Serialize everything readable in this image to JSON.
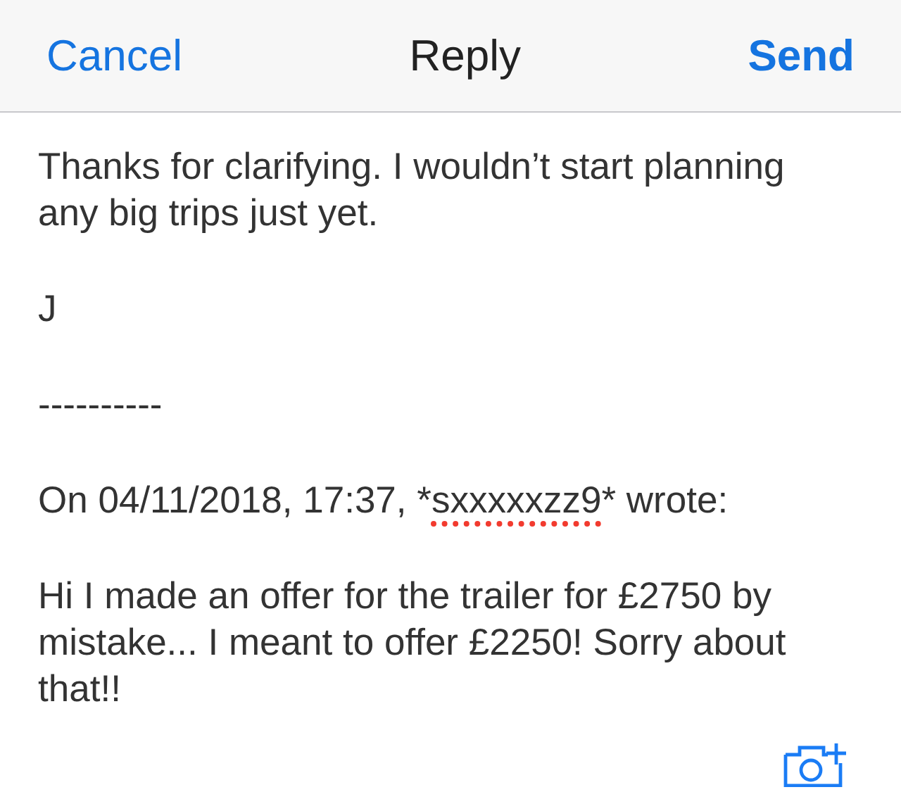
{
  "nav_bar": {
    "cancel": "Cancel",
    "title": "Reply",
    "send": "Send"
  },
  "body": [
    {
      "segments": [
        {
          "text": "Thanks for clarifying. I wouldn’t start planning any big trips just yet.",
          "misspelled": false
        }
      ]
    },
    {
      "segments": [
        {
          "text": "J",
          "misspelled": false
        }
      ]
    },
    {
      "segments": [
        {
          "text": "----------",
          "misspelled": false
        }
      ]
    },
    {
      "segments": [
        {
          "text": "On 04/11/2018, 17:37, *",
          "misspelled": false
        },
        {
          "text": "sxxxxxzz9",
          "misspelled": true
        },
        {
          "text": "* wrote:",
          "misspelled": false
        }
      ]
    },
    {
      "segments": [
        {
          "text": "Hi I made an offer for the trailer for £2750 by mistake... I meant to offer £2250! Sorry about that!!",
          "misspelled": false
        }
      ]
    }
  ]
}
